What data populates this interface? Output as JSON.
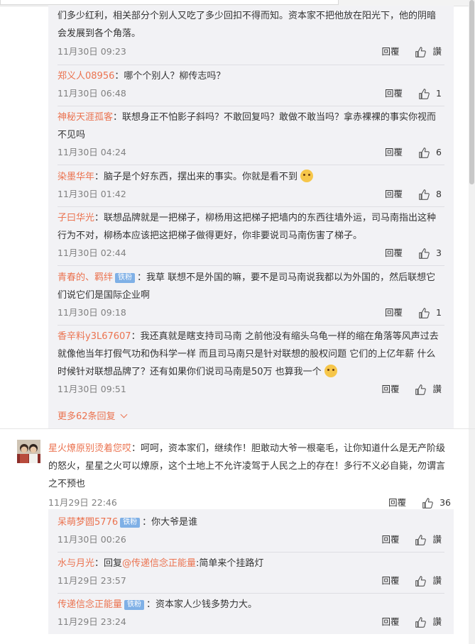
{
  "topbar": {
    "cut_text": "...不把他放在阳光下，他的阴暗"
  },
  "first_group": {
    "replies": [
      {
        "user": "",
        "text": "们多少红利，相关部分个别人又吃了多少回扣不得而知。资本家不把他放在阳光下，他的阴暗会发展到各个角落。",
        "time": "11月30日 09:23",
        "reply_label": "回覆",
        "likes": "讚"
      },
      {
        "user": "郑义人08956",
        "text": "：哪个个别人？柳传志吗？",
        "time": "11月30日 06:48",
        "reply_label": "回覆",
        "likes": "1"
      },
      {
        "user": "神秘天涯孤客",
        "text": "：联想身正不怕影子斜吗？不敢回复吗？敢做不敢当吗？拿赤裸裸的事实你视而不见吗",
        "time": "11月30日 04:24",
        "reply_label": "回覆",
        "likes": "6"
      },
      {
        "user": "染墨华年",
        "text": "：脑子是个好东西，摆出来的事实。你就是看不到",
        "time": "11月30日 01:42",
        "reply_label": "回覆",
        "likes": "8"
      },
      {
        "user": "子曰华光",
        "text": "：联想品牌就是一把梯子，柳杨用这把梯子把墙内的东西往墙外运，司马南指出这种行为不对，柳杨本应该把这把梯子做得更好，你非要说司马南伤害了梯子。",
        "time": "11月30日 02:44",
        "reply_label": "回覆",
        "likes": "3"
      },
      {
        "user": "青春的、羁绊",
        "badge": "铁粉",
        "text": "：我草 联想不是外国的嘛，要不是司马南说我都以为外国的，然后联想它们说它们是国际企业啊",
        "time": "11月30日 09:18",
        "reply_label": "回覆",
        "likes": "1"
      },
      {
        "user": "香辛料y3L67607",
        "text": "：我还真就是瞎支持司马南 之前他没有缩头乌龟一样的缩在角落等风声过去 就像他当年打假气功和伪科学一样 而且司马南只是针对联想的股权问题 它们的上亿年薪 什么时候针对联想品牌了？还有如果你们说司马南是50万 也算我一个",
        "time": "11月30日 09:51",
        "reply_label": "回覆",
        "likes": "讚"
      }
    ],
    "more_label": "更多62条回复"
  },
  "main_comment": {
    "user": "星火燎原别烫着您哎",
    "text": "：呵呵，资本家们，继续作！胆敢动大爷一根毫毛，让你知道什么是无产阶级的怒火，星星之火可以燎原，这个土地上不允许凌驾于人民之上的存在！多行不义必自毙，勿谓言之不预也",
    "time": "11月29日 22:46",
    "reply_label": "回覆",
    "likes": "36"
  },
  "second_group": {
    "replies": [
      {
        "user": "呆萌梦圆5776",
        "badge": "铁粉",
        "text": "：你大爷是谁",
        "time": "11月30日 00:26",
        "reply_label": "回覆",
        "likes": "讚"
      },
      {
        "user": "水与月光",
        "text": "：回复",
        "mention": "@传递信念正能量",
        "text2": ":简单来个挂路灯",
        "time": "11月29日 23:57",
        "reply_label": "回覆",
        "likes": "讚"
      },
      {
        "user": "传递信念正能量",
        "badge": "铁粉",
        "text": "：资本家人少钱多势力大。",
        "time": "11月29日 23:24",
        "reply_label": "回覆",
        "likes": "讚"
      }
    ]
  }
}
